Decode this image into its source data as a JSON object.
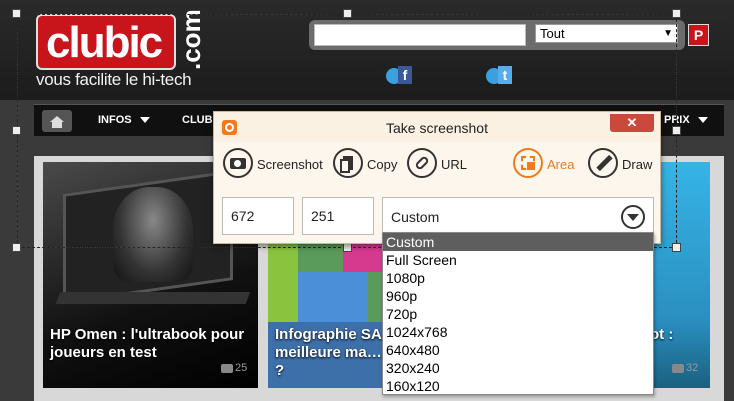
{
  "site": {
    "logo_word": "clubic",
    "logo_com": ".com",
    "tagline": "vous facilite le hi-tech",
    "search_input_value": "",
    "search_select_value": "Tout",
    "search_go_label": "P",
    "social": {
      "fb": "f",
      "tw": "t"
    },
    "nav": [
      {
        "label": "INFOS"
      },
      {
        "label": "CLUB"
      },
      {
        "label": "PRIX"
      }
    ],
    "cards": [
      {
        "title": "HP Omen : l'ultrabook pour joueurs en test",
        "comments": "25"
      },
      {
        "title": "Infographie SA… la meilleure ma… smartphone ?",
        "comments": ""
      },
      {
        "title": "ot :",
        "comments": "32"
      }
    ]
  },
  "dialog": {
    "title": "Take screenshot",
    "close_label": "✕",
    "tools": [
      {
        "label": "Screenshot"
      },
      {
        "label": "Copy"
      },
      {
        "label": "URL"
      },
      {
        "label": "Area"
      },
      {
        "label": "Draw"
      }
    ],
    "width_value": "672",
    "height_value": "251",
    "size_selected": "Custom",
    "size_options": [
      "Custom",
      "Full Screen",
      "1080p",
      "960p",
      "720p",
      "1024x768",
      "640x480",
      "320x240",
      "160x120"
    ]
  },
  "colors": {
    "accent": "#f07a1c",
    "brand_red": "#c8141b",
    "close_red": "#c94a3c",
    "selected_bg": "#5e5e5e"
  }
}
